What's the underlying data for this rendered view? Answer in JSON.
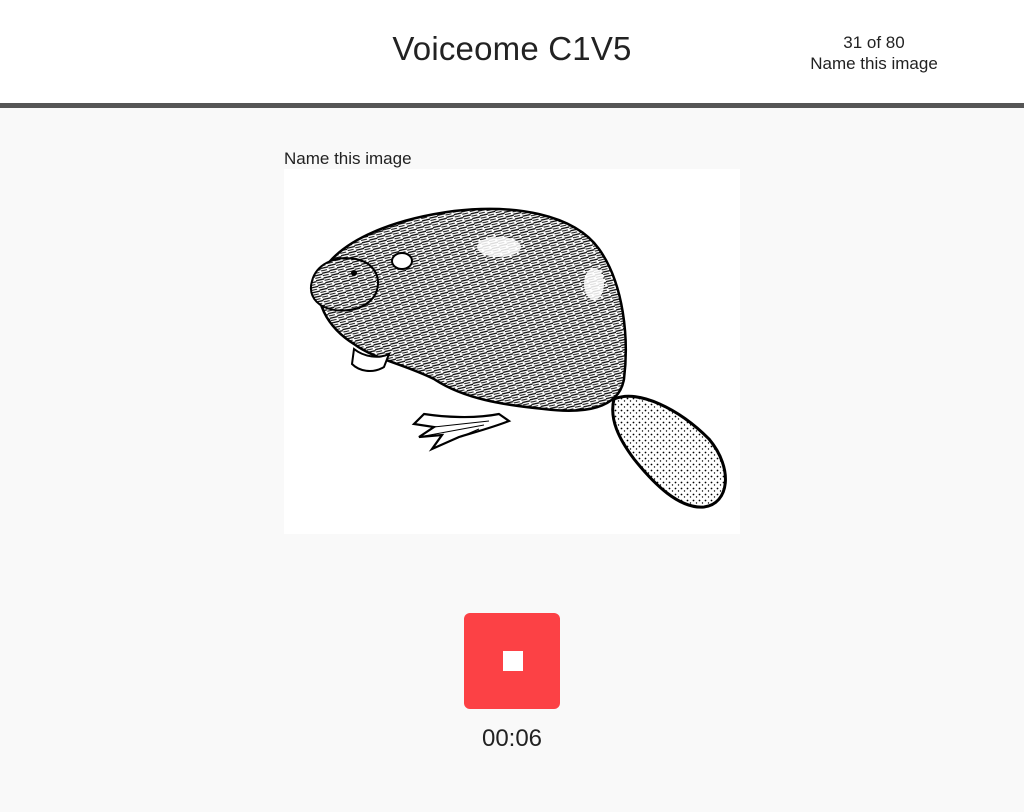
{
  "header": {
    "title": "Voiceome C1V5",
    "progress": "31 of 80",
    "task_name": "Name this image"
  },
  "main": {
    "prompt": "Name this image",
    "stimulus_icon": "beaver-illustration",
    "record_button_icon": "stop-icon",
    "timer": "00:06"
  },
  "colors": {
    "header_bg": "#ffffff",
    "header_border": "#555555",
    "page_bg": "#f9f9f9",
    "record_button": "#fc4145"
  }
}
